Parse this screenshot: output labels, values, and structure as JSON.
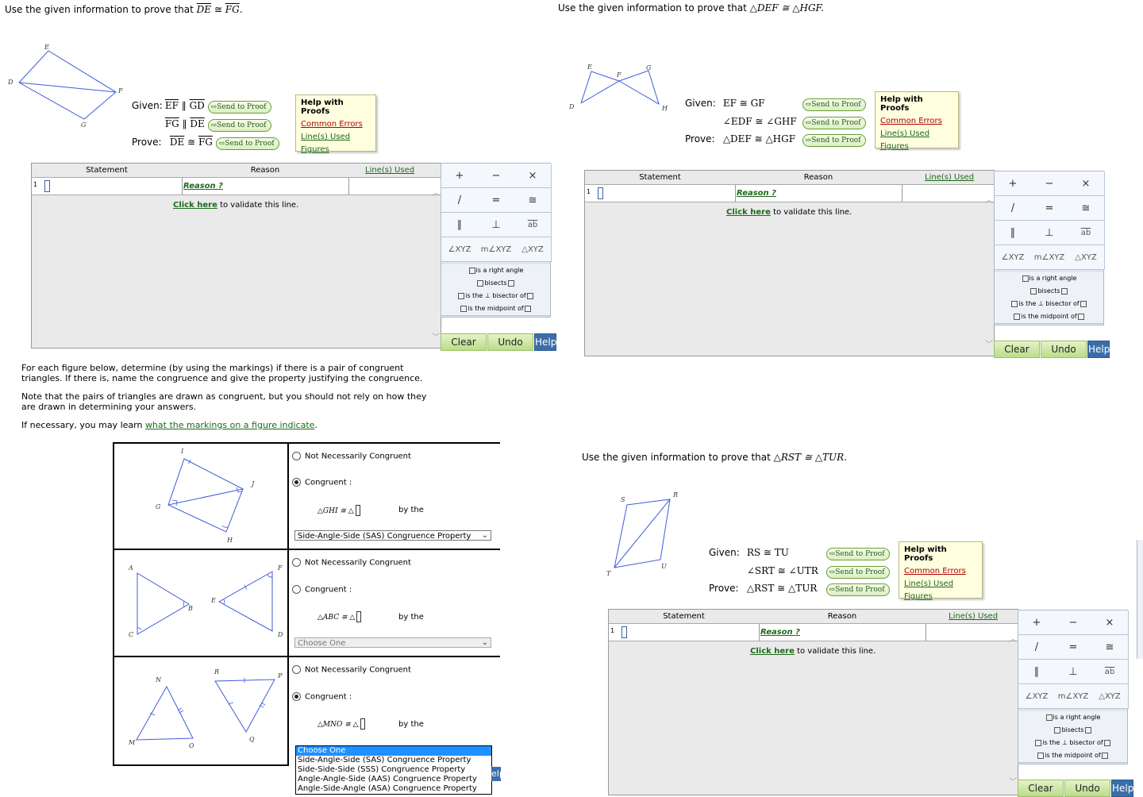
{
  "problems": [
    {
      "title_prefix": "Use the given information to prove that",
      "goal_a": "DE",
      "goal_rel": "≅",
      "goal_b": "FG",
      "goal_suffix": ".",
      "fig_labels": {
        "D": "D",
        "E": "E",
        "F": "F",
        "G": "G"
      },
      "given": [
        {
          "label": "Given:",
          "a": "EF",
          "rel": "∥",
          "b": "GD"
        },
        {
          "label": "",
          "a": "FG",
          "rel": "∥",
          "b": "DE"
        }
      ],
      "prove": {
        "label": "Prove:",
        "a": "DE",
        "rel": "≅",
        "b": "FG"
      }
    },
    {
      "title_prefix": "Use the given information to prove that",
      "goal": "△DEF ≅ △HGF.",
      "fig_labels": {
        "D": "D",
        "E": "E",
        "F": "F",
        "G": "G",
        "H": "H"
      },
      "given": [
        {
          "label": "Given:",
          "text": "EF ≅ GF"
        },
        {
          "label": "",
          "text": "∠EDF ≅ ∠GHF"
        }
      ],
      "prove": {
        "label": "Prove:",
        "text": "△DEF ≅ △HGF"
      }
    },
    {
      "title_prefix": "Use the given information to prove that",
      "goal": "△RST ≅ △TUR.",
      "fig_labels": {
        "R": "R",
        "S": "S",
        "T": "T",
        "U": "U"
      },
      "given": [
        {
          "label": "Given:",
          "text": "RS ≅ TU"
        },
        {
          "label": "",
          "text": "∠SRT ≅ ∠UTR"
        }
      ],
      "prove": {
        "label": "Prove:",
        "text": "△RST ≅ △TUR"
      }
    }
  ],
  "send_to_proof": "Send to Proof",
  "help_box": {
    "title": "Help with Proofs",
    "links": [
      "Common Errors",
      "Line(s) Used",
      "Figures"
    ]
  },
  "proof_table": {
    "col_statement": "Statement",
    "col_reason": "Reason",
    "col_lines": "Line(s) Used",
    "row_number": "1",
    "reason_placeholder": "Reason ?",
    "click_here": "Click here",
    "click_rest": "to validate this line."
  },
  "palette": {
    "row1": [
      "+",
      "−",
      "×"
    ],
    "row2": [
      "/",
      "=",
      "≅"
    ],
    "row3": [
      "∥",
      "⊥",
      "ab"
    ],
    "row4": [
      "∠XYZ",
      "m∠XYZ",
      "△XYZ"
    ],
    "lines": [
      {
        "pre": "",
        "mid": "is a right angle",
        "post": ""
      },
      {
        "pre": "",
        "mid": "bisects",
        "post": ""
      },
      {
        "pre": "",
        "mid": "is the ⊥ bisector of",
        "post": ""
      },
      {
        "pre": "",
        "mid": "is the midpoint of",
        "post": ""
      }
    ],
    "clear": "Clear",
    "undo": "Undo",
    "help": "Help"
  },
  "instructions": {
    "p1": "For each figure below, determine (by using the markings) if there is a pair of congruent triangles. If there is, name the congruence and give the property justifying the congruence.",
    "p2": "Note that the pairs of triangles are drawn as congruent, but you should not rely on how they are drawn in determining your answers.",
    "p3_pre": "If necessary, you may learn",
    "p3_link": "what the markings on a figure indicate",
    "p3_post": "."
  },
  "congruence": {
    "not_cong": "Not Necessarily Congruent",
    "cong": "Congruent :",
    "by_the": "by the",
    "items": [
      {
        "labels": [
          "I",
          "J",
          "G",
          "H"
        ],
        "tri": "△GHI ≅ △",
        "selected": "congruent",
        "select_value": "Side-Angle-Side (SAS) Congruence Property"
      },
      {
        "labels": [
          "A",
          "F",
          "E",
          "B",
          "C",
          "D"
        ],
        "tri": "△ABC ≅ △",
        "selected": "none",
        "select_value": "Choose One"
      },
      {
        "labels": [
          "N",
          "R",
          "P",
          "M",
          "O",
          "Q"
        ],
        "tri": "△MNO ≅ △",
        "selected": "congruent",
        "select_value": "Choose One"
      }
    ],
    "dropdown_options": [
      "Choose One",
      "Side-Angle-Side (SAS) Congruence Property",
      "Side-Side-Side (SSS) Congruence Property",
      "Angle-Angle-Side (AAS) Congruence Property",
      "Angle-Side-Angle (ASA) Congruence Property"
    ],
    "overlap_text": "elp"
  },
  "colors": {
    "figure": "#3d5ddb",
    "link_green": "#1c6a1c",
    "link_red": "#b00000",
    "help_blue": "#3a6ea8"
  }
}
